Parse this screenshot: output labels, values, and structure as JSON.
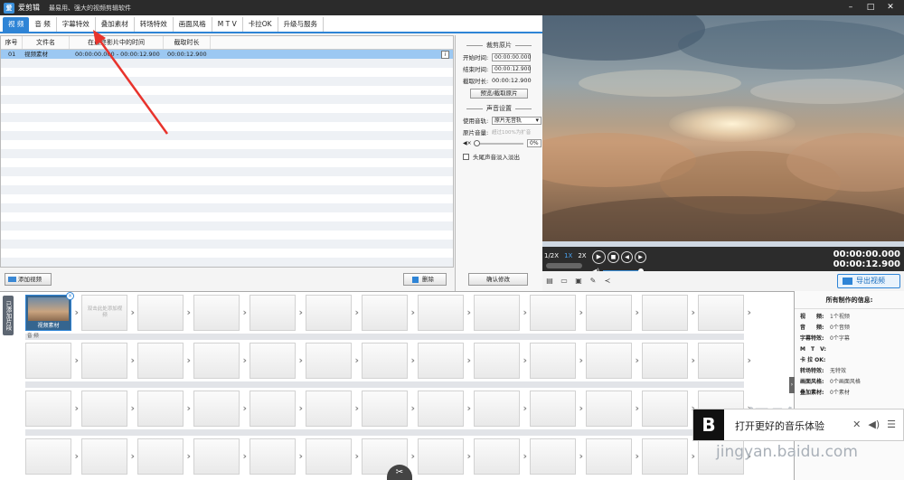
{
  "app": {
    "logo_text": "爱",
    "name": "爱剪辑",
    "slogan": "最易用、强大的视频剪辑软件",
    "win_controls": [
      "–",
      "□",
      "✕"
    ]
  },
  "tabs": [
    "视 频",
    "音 频",
    "字幕特效",
    "叠加素材",
    "转场特效",
    "画面风格",
    "M T V",
    "卡拉OK",
    "升级与服务"
  ],
  "file_list": {
    "columns": [
      "序号",
      "文件名",
      "在最终影片中的时间",
      "截取时长"
    ],
    "rows": [
      {
        "index": "01",
        "name": "视频素材",
        "time": "00:00:00.000 - 00:00:12.900",
        "duration": "00:00:12.900"
      }
    ],
    "info_glyph": "i"
  },
  "settings": {
    "clip_section_title": "裁剪原片",
    "start_label": "开始时间:",
    "start_value": "00:00:00.000",
    "end_label": "结束时间:",
    "end_value": "00:00:12.900",
    "duration_label": "截取时长:",
    "duration_value": "00:00:12.900",
    "preview_button": "预览/截取原片",
    "audio_section_title": "声音设置",
    "track_label": "使用音轨:",
    "track_value": "原片无音轨",
    "volume_label": "原片音量:",
    "volume_hint": "超过100%为扩音",
    "volume_value": "0%",
    "fade_label": "头尾声音淡入淡出",
    "confirm_button": "确认修改"
  },
  "list_actions": {
    "add_video": "添加视频",
    "delete": "删除"
  },
  "player": {
    "progress": 0.0,
    "speeds": [
      "1/2X",
      "1X",
      "2X"
    ],
    "current_time": "00:00:00.000",
    "total_time": "00:00:12.900",
    "export_button": "导出视频"
  },
  "timeline": {
    "side_label": "已添加片段",
    "video_clip_label": "视频素材",
    "add_slot_text": "双击此处添加视频",
    "audio_track_label": "音 频"
  },
  "info_panel": {
    "title": "所有制作的信息:",
    "rows": [
      {
        "k": "视　　频:",
        "v": "1个视频"
      },
      {
        "k": "音　　频:",
        "v": "0个音频"
      },
      {
        "k": "字幕特效:",
        "v": "0个字幕"
      },
      {
        "k": "M　T　V:",
        "v": ""
      },
      {
        "k": "卡 拉 OK:",
        "v": ""
      },
      {
        "k": "转场特效:",
        "v": "无特效"
      },
      {
        "k": "画面风格:",
        "v": "0个画面风格"
      },
      {
        "k": "叠加素材:",
        "v": "0个素材"
      }
    ]
  },
  "overlay": {
    "text": "打开更好的音乐体验",
    "watermark": "jingyan.baidu.com",
    "watermark_brand": "Bai经验"
  },
  "colors": {
    "accent": "#2e84d6",
    "titlebar": "#2b2b2b",
    "annotation": "#e8332c"
  }
}
